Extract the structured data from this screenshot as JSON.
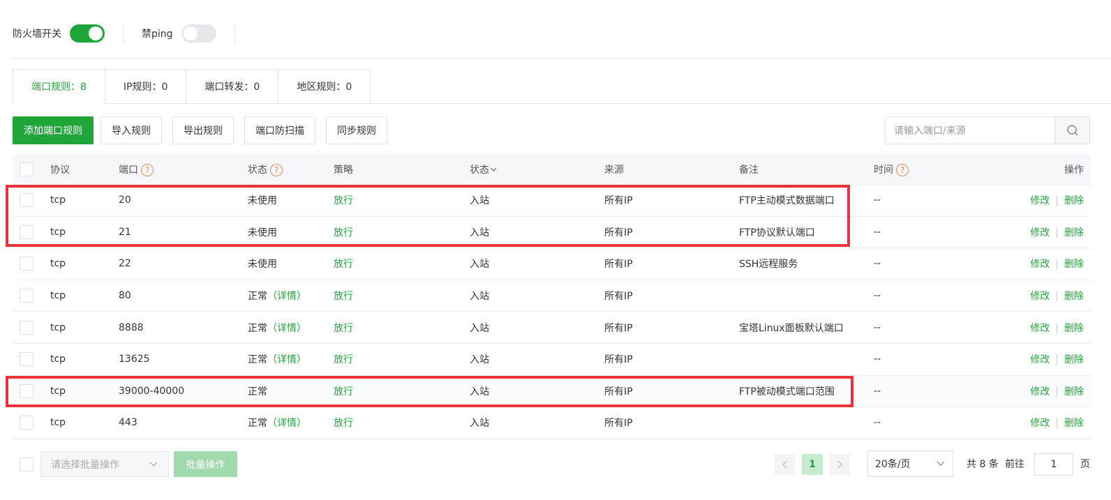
{
  "toggles": {
    "firewall_label": "防火墙开关",
    "ping_label": "禁ping"
  },
  "tabs": [
    {
      "label": "端口规则：8"
    },
    {
      "label": "IP规则：0"
    },
    {
      "label": "端口转发：0"
    },
    {
      "label": "地区规则：0"
    }
  ],
  "toolbar": {
    "add": "添加端口规则",
    "import": "导入规则",
    "export": "导出规则",
    "scan": "端口防扫描",
    "sync": "同步规则"
  },
  "search": {
    "placeholder": "请输入端口/来源"
  },
  "columns": {
    "protocol": "协议",
    "port": "端口",
    "status": "状态",
    "policy": "策略",
    "direction": "状态",
    "source": "来源",
    "note": "备注",
    "time": "时间",
    "ops": "操作"
  },
  "rows": [
    {
      "protocol": "tcp",
      "port": "20",
      "status": "未使用",
      "detail": "",
      "policy": "放行",
      "direction": "入站",
      "source": "所有IP",
      "note": "FTP主动模式数据端口",
      "time": "--"
    },
    {
      "protocol": "tcp",
      "port": "21",
      "status": "未使用",
      "detail": "",
      "policy": "放行",
      "direction": "入站",
      "source": "所有IP",
      "note": "FTP协议默认端口",
      "time": "--"
    },
    {
      "protocol": "tcp",
      "port": "22",
      "status": "未使用",
      "detail": "",
      "policy": "放行",
      "direction": "入站",
      "source": "所有IP",
      "note": "SSH远程服务",
      "time": "--"
    },
    {
      "protocol": "tcp",
      "port": "80",
      "status": "正常",
      "detail": "（详情）",
      "policy": "放行",
      "direction": "入站",
      "source": "所有IP",
      "note": "",
      "time": "--"
    },
    {
      "protocol": "tcp",
      "port": "8888",
      "status": "正常",
      "detail": "（详情）",
      "policy": "放行",
      "direction": "入站",
      "source": "所有IP",
      "note": "宝塔Linux面板默认端口",
      "time": "--"
    },
    {
      "protocol": "tcp",
      "port": "13625",
      "status": "正常",
      "detail": "（详情）",
      "policy": "放行",
      "direction": "入站",
      "source": "所有IP",
      "note": "",
      "time": "--"
    },
    {
      "protocol": "tcp",
      "port": "39000-40000",
      "status": "正常",
      "detail": "",
      "policy": "放行",
      "direction": "入站",
      "source": "所有IP",
      "note": "FTP被动模式端口范围",
      "time": "--"
    },
    {
      "protocol": "tcp",
      "port": "443",
      "status": "正常",
      "detail": "（详情）",
      "policy": "放行",
      "direction": "入站",
      "source": "所有IP",
      "note": "",
      "time": "--"
    }
  ],
  "ops": {
    "edit": "修改",
    "delete": "删除"
  },
  "footer": {
    "batch_placeholder": "请选择批量操作",
    "batch_button": "批量操作",
    "current_page": "1",
    "page_size": "20条/页",
    "total": "共 8 条",
    "goto_label": "前往",
    "goto_value": "1",
    "page_suffix": "页"
  },
  "colors": {
    "accent": "#20a53a",
    "highlight_border": "#e8333a",
    "help_icon": "#f0874a"
  }
}
